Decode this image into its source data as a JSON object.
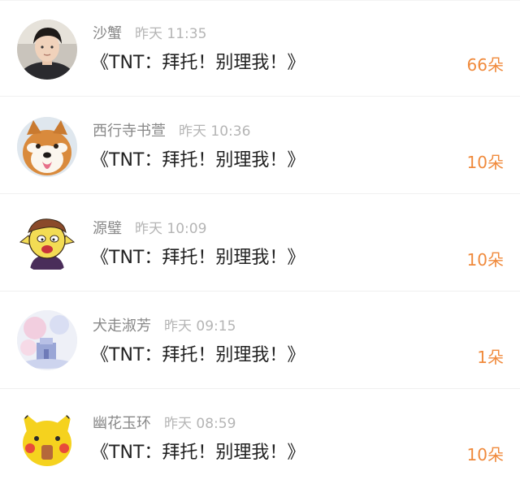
{
  "rewards": [
    {
      "avatar_icon": "boy-portrait-avatar",
      "username": "沙蟹",
      "time": "昨天 11:35",
      "title": "《TNT：拜托！别理我！》",
      "count": "66朵"
    },
    {
      "avatar_icon": "shiba-dog-avatar",
      "username": "西行寺书萱",
      "time": "昨天 10:36",
      "title": "《TNT：拜托！别理我！》",
      "count": "10朵"
    },
    {
      "avatar_icon": "cartoon-man-avatar",
      "username": "源璧",
      "time": "昨天 10:09",
      "title": "《TNT：拜托！别理我！》",
      "count": "10朵"
    },
    {
      "avatar_icon": "pastel-art-avatar",
      "username": "犬走淑芳",
      "time": "昨天 09:15",
      "title": "《TNT：拜托！别理我！》",
      "count": "1朵"
    },
    {
      "avatar_icon": "yellow-mascot-avatar",
      "username": "幽花玉环",
      "time": "昨天 08:59",
      "title": "《TNT：拜托！别理我！》",
      "count": "10朵"
    }
  ],
  "colors": {
    "accent": "#f08a3c",
    "username": "#888888",
    "time": "#b5b5b5",
    "title": "#222222"
  }
}
